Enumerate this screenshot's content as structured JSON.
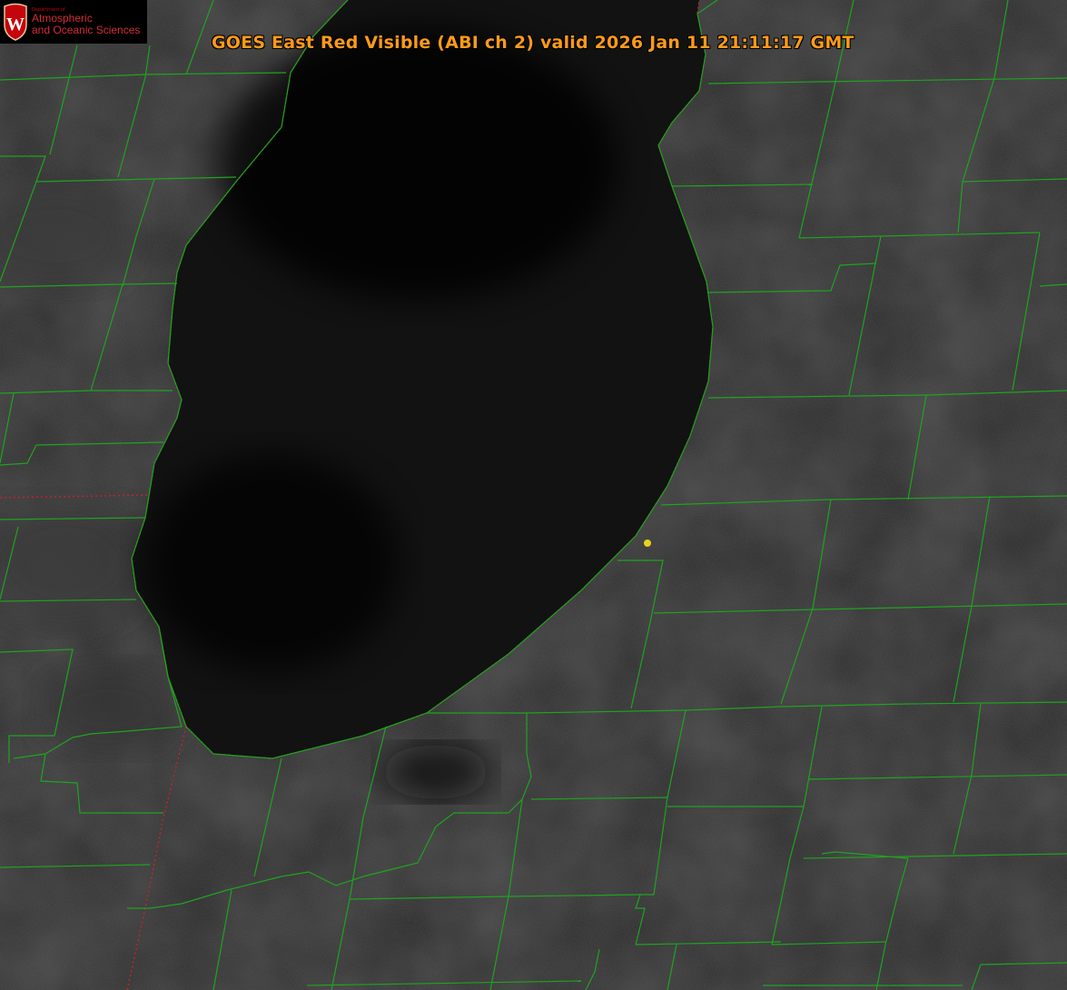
{
  "header": {
    "title": "GOES East Red Visible (ABI ch 2) valid 2026 Jan 11 21:11:17 GMT"
  },
  "logo": {
    "department": "Department of",
    "name_line1": "Atmospheric",
    "name_line2": "and Oceanic Sciences",
    "crest_letter": "W"
  },
  "colors": {
    "county_lines": "#1fa31f",
    "state_lines": "#d0202a",
    "marker": "#e8d21c",
    "title": "#ff9a1a",
    "lake": "#0a0a0a",
    "land": "#232323"
  },
  "icons": {
    "crest": "uw-crest-icon",
    "marker": "location-dot-icon"
  }
}
